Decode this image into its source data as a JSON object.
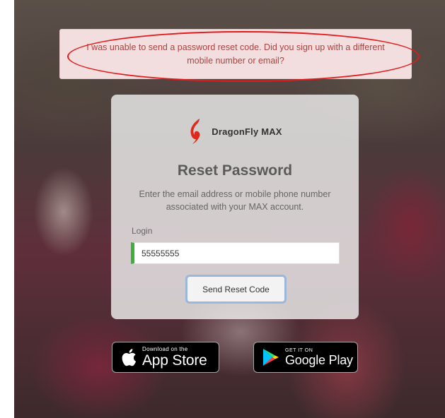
{
  "alert": {
    "message": "I was unable to send a password reset code. Did you sign up with a different mobile number or email?"
  },
  "brand": {
    "name": "DragonFly MAX",
    "accent_color": "#e0281b"
  },
  "card": {
    "title": "Reset Password",
    "description": "Enter the email address or mobile phone number associated with your MAX account."
  },
  "form": {
    "login_label": "Login",
    "login_value": "55555555",
    "submit_label": "Send Reset Code"
  },
  "badges": {
    "app_store": {
      "small": "Download on the",
      "big": "App Store",
      "icon": "apple-icon"
    },
    "google_play": {
      "small": "GET IT ON",
      "big": "Google Play",
      "icon": "google-play-icon"
    }
  },
  "colors": {
    "alert_bg": "#f2dede",
    "alert_text": "#a94442",
    "highlight": "#e11b1b",
    "input_valid": "#3bb03b"
  }
}
